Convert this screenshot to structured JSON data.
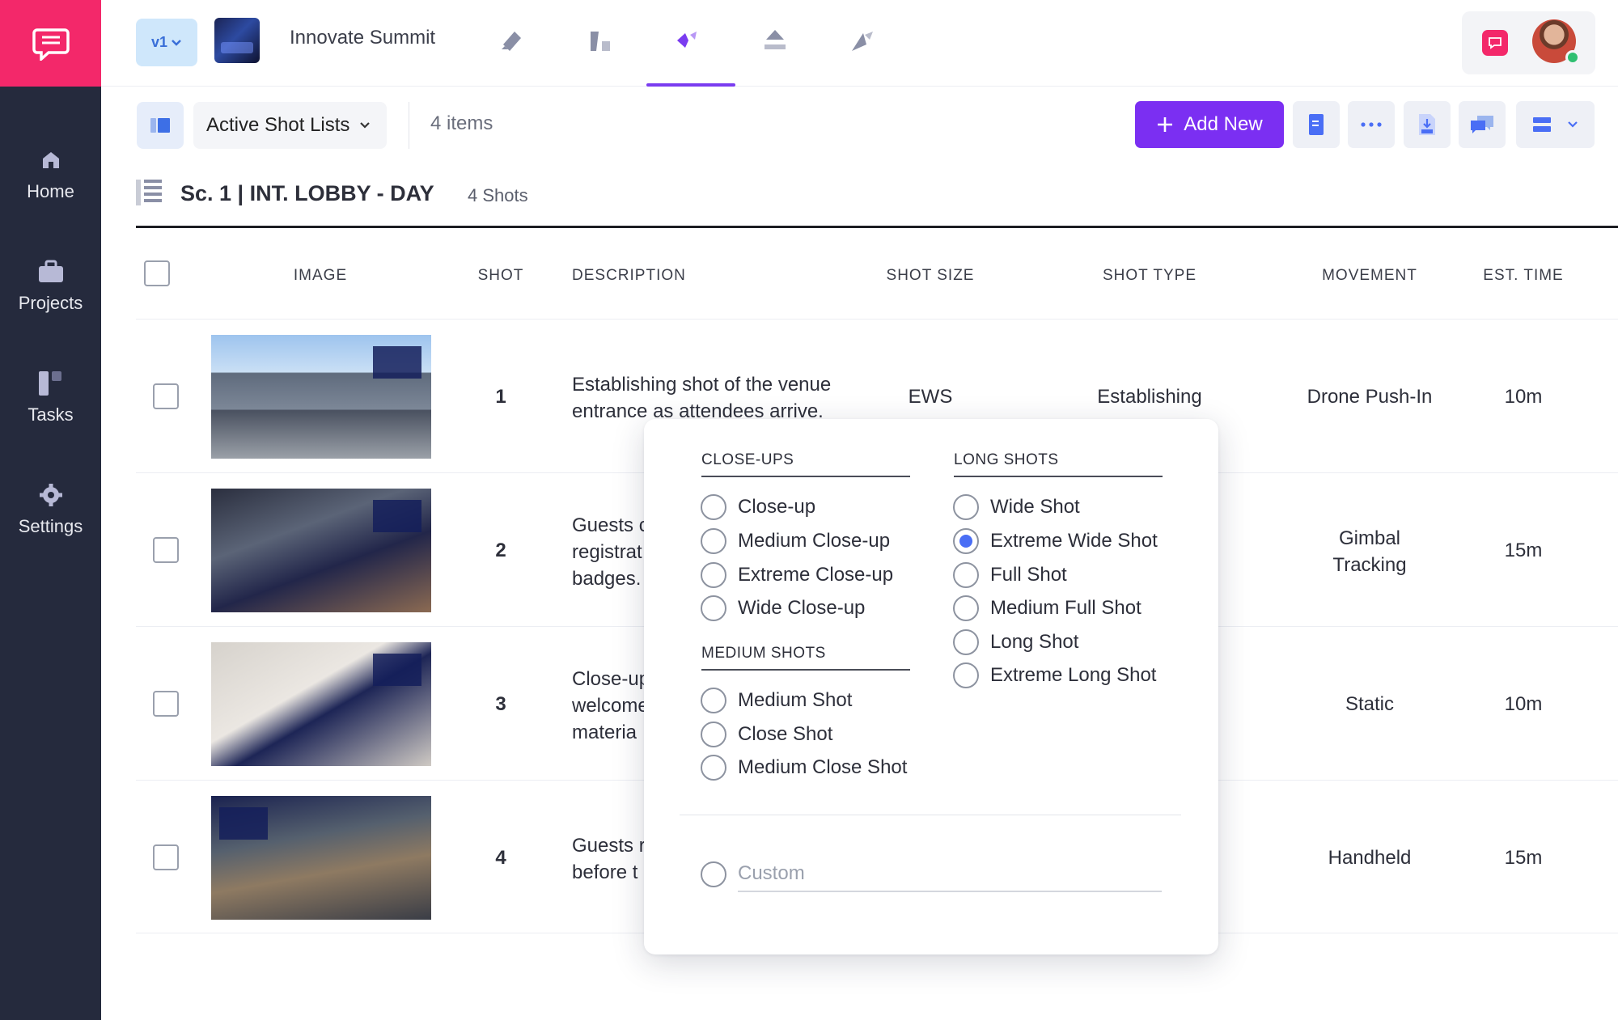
{
  "sidebar": {
    "items": [
      {
        "label": "Home",
        "icon": "home-icon"
      },
      {
        "label": "Projects",
        "icon": "briefcase-icon"
      },
      {
        "label": "Tasks",
        "icon": "tasks-icon"
      },
      {
        "label": "Settings",
        "icon": "gear-icon"
      }
    ]
  },
  "topbar": {
    "version": "v1",
    "project_name": "Innovate Summit",
    "tools": [
      "script-tool-icon",
      "storyboard-tool-icon",
      "shotlist-tool-icon",
      "schedule-tool-icon",
      "callsheet-tool-icon"
    ],
    "active_tool": 2
  },
  "toolbar": {
    "list_name": "Active Shot Lists",
    "item_count": "4 items",
    "add_new": "Add New"
  },
  "scene": {
    "title": "Sc. 1 | INT. LOBBY - DAY",
    "count": "4 Shots"
  },
  "table": {
    "headers": {
      "image": "IMAGE",
      "shot": "SHOT",
      "description": "DESCRIPTION",
      "shot_size": "SHOT SIZE",
      "shot_type": "SHOT TYPE",
      "movement": "MOVEMENT",
      "est_time": "EST. TIME"
    },
    "rows": [
      {
        "shot": "1",
        "desc_line1": "Establishing shot of the venue",
        "desc_line2": "entrance as attendees arrive.",
        "desc_line3": "",
        "shot_size": "EWS",
        "shot_type": "Establishing",
        "move_line1": "Drone Push-In",
        "move_line2": "",
        "time": "10m"
      },
      {
        "shot": "2",
        "desc_line1": "Guests c",
        "desc_line2": "registrat",
        "desc_line3": "badges.",
        "shot_size": "",
        "shot_type": "",
        "move_line1": "Gimbal",
        "move_line2": "Tracking",
        "time": "15m"
      },
      {
        "shot": "3",
        "desc_line1": "Close-up",
        "desc_line2": "welcome",
        "desc_line3": "materia",
        "shot_size": "",
        "shot_type": "",
        "move_line1": "Static",
        "move_line2": "",
        "time": "10m"
      },
      {
        "shot": "4",
        "desc_line1": "Guests r",
        "desc_line2": "before t",
        "desc_line3": "",
        "shot_size": "",
        "shot_type": "",
        "move_line1": "Handheld",
        "move_line2": "",
        "time": "15m"
      }
    ]
  },
  "popup": {
    "close_ups": {
      "title": "CLOSE-UPS",
      "options": [
        "Close-up",
        "Medium Close-up",
        "Extreme Close-up",
        "Wide Close-up"
      ]
    },
    "medium_shots": {
      "title": "MEDIUM SHOTS",
      "options": [
        "Medium Shot",
        "Close Shot",
        "Medium Close Shot"
      ]
    },
    "long_shots": {
      "title": "LONG SHOTS",
      "options": [
        "Wide Shot",
        "Extreme Wide Shot",
        "Full Shot",
        "Medium Full Shot",
        "Long Shot",
        "Extreme Long Shot"
      ],
      "selected": "Extreme Wide Shot"
    },
    "custom_placeholder": "Custom"
  },
  "colors": {
    "sidebar": "#252a3d",
    "brand": "#f3286a",
    "accent": "#7b2ff2",
    "radio_selected": "#4a6ef5"
  }
}
